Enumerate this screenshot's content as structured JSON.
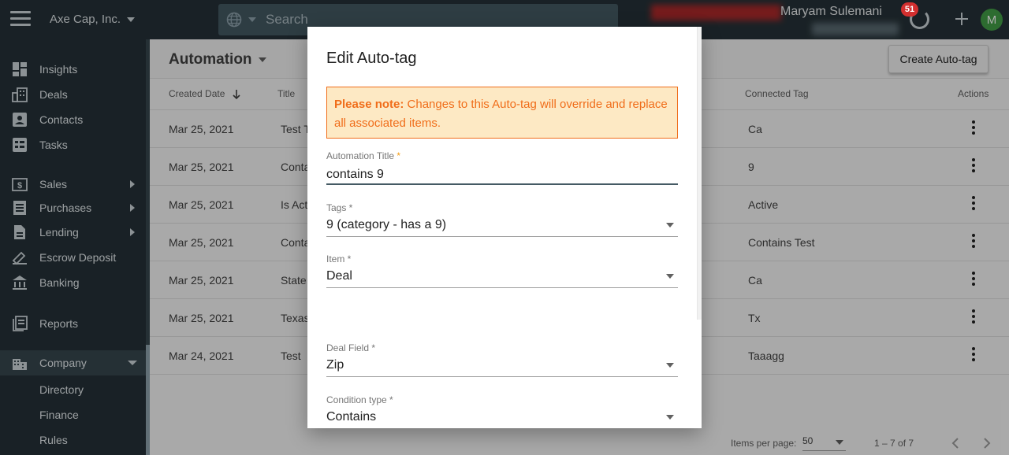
{
  "app": {
    "company": "Axe Cap, Inc.",
    "search_placeholder": "Search",
    "user_name": "Maryam Sulemani",
    "notification_count": "51",
    "avatar_initial": "M"
  },
  "sidebar": {
    "items": [
      {
        "label": "Insights",
        "icon": "insights-icon"
      },
      {
        "label": "Deals",
        "icon": "deals-icon"
      },
      {
        "label": "Contacts",
        "icon": "contacts-icon"
      },
      {
        "label": "Tasks",
        "icon": "tasks-icon"
      },
      {
        "label": "Sales",
        "icon": "sales-icon"
      },
      {
        "label": "Purchases",
        "icon": "purchases-icon"
      },
      {
        "label": "Lending",
        "icon": "lending-icon"
      },
      {
        "label": "Escrow Deposit",
        "icon": "escrow-icon"
      },
      {
        "label": "Banking",
        "icon": "bank-icon"
      },
      {
        "label": "Reports",
        "icon": "reports-icon"
      },
      {
        "label": "Company",
        "icon": "company-icon"
      }
    ],
    "subitems": [
      "Directory",
      "Finance",
      "Rules"
    ]
  },
  "main": {
    "title": "Automation",
    "create_button": "Create Auto-tag",
    "columns": {
      "created_date": "Created Date",
      "title": "Title",
      "connected_tag": "Connected Tag",
      "actions": "Actions"
    },
    "rows": [
      {
        "date": "Mar 25, 2021",
        "title": "Test T",
        "tag": "Ca"
      },
      {
        "date": "Mar 25, 2021",
        "title": "Conta",
        "tag": "9"
      },
      {
        "date": "Mar 25, 2021",
        "title": "Is Act",
        "tag": "Active"
      },
      {
        "date": "Mar 25, 2021",
        "title": "Conta",
        "tag": "Contains Test"
      },
      {
        "date": "Mar 25, 2021",
        "title": "State",
        "tag": "Ca"
      },
      {
        "date": "Mar 25, 2021",
        "title": "Texas",
        "tag": "Tx"
      },
      {
        "date": "Mar 24, 2021",
        "title": "Test",
        "tag": "Taaagg"
      }
    ],
    "items_per_page_label": "Items per page:",
    "items_per_page": "50",
    "range": "1 – 7 of 7"
  },
  "modal": {
    "title": "Edit Auto-tag",
    "note_bold": "Please note:",
    "note_text": " Changes to this Auto-tag will override and replace all associated items.",
    "fields": {
      "automation_title": {
        "label": "Automation Title",
        "value": "contains 9"
      },
      "tags": {
        "label": "Tags *",
        "value": "9 (category - has a 9)"
      },
      "item": {
        "label": "Item *",
        "value": "Deal"
      },
      "deal_field": {
        "label": "Deal Field *",
        "value": "Zip"
      },
      "condition_type": {
        "label": "Condition type *",
        "value": "Contains"
      }
    }
  },
  "colors": {
    "sidebar_bg": "#263238",
    "note_border": "#f06d1a",
    "note_bg": "#fde9c4",
    "avatar_bg": "#43a047",
    "badge_bg": "#d32f2f"
  }
}
